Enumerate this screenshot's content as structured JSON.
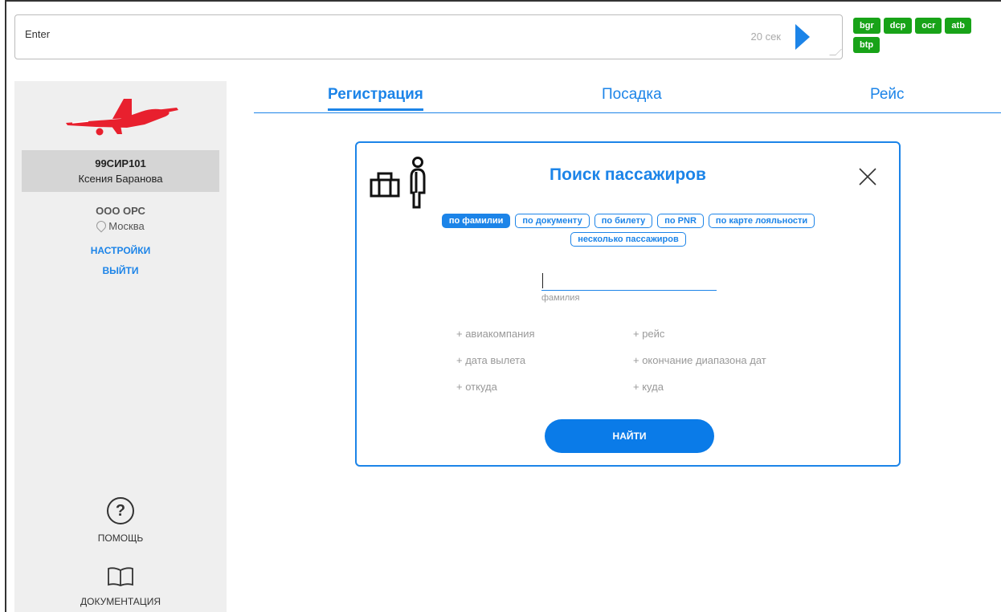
{
  "command_bar": {
    "input_value": "Enter",
    "timer": "20 сек"
  },
  "tags": [
    "bgr",
    "dcp",
    "ocr",
    "atb",
    "btp"
  ],
  "sidebar": {
    "user_code": "99СИР101",
    "user_name": "Ксения Баранова",
    "org": "ООО ОРС",
    "city": "Москва",
    "settings": "НАСТРОЙКИ",
    "logout": "ВЫЙТИ",
    "help": "ПОМОЩЬ",
    "docs": "ДОКУМЕНТАЦИЯ"
  },
  "tabs": [
    {
      "label": "Регистрация",
      "active": true
    },
    {
      "label": "Посадка",
      "active": false
    },
    {
      "label": "Рейс",
      "active": false
    }
  ],
  "dialog": {
    "title": "Поиск пассажиров",
    "modes": [
      {
        "label": "по фамилии",
        "active": true
      },
      {
        "label": "по документу",
        "active": false
      },
      {
        "label": "по билету",
        "active": false
      },
      {
        "label": "по PNR",
        "active": false
      },
      {
        "label": "по карте лояльности",
        "active": false
      },
      {
        "label": "несколько пассажиров",
        "active": false
      }
    ],
    "surname_value": "",
    "surname_label": "фамилия",
    "options": {
      "airline": "+ авиакомпания",
      "flight": "+ рейс",
      "departure_date": "+ дата вылета",
      "date_range_end": "+ окончание диапазона дат",
      "from": "+ откуда",
      "to": "+ куда"
    },
    "find_button": "НАЙТИ"
  },
  "colors": {
    "accent": "#1c84e8",
    "tag": "#18a318",
    "logo": "#e8202e"
  }
}
